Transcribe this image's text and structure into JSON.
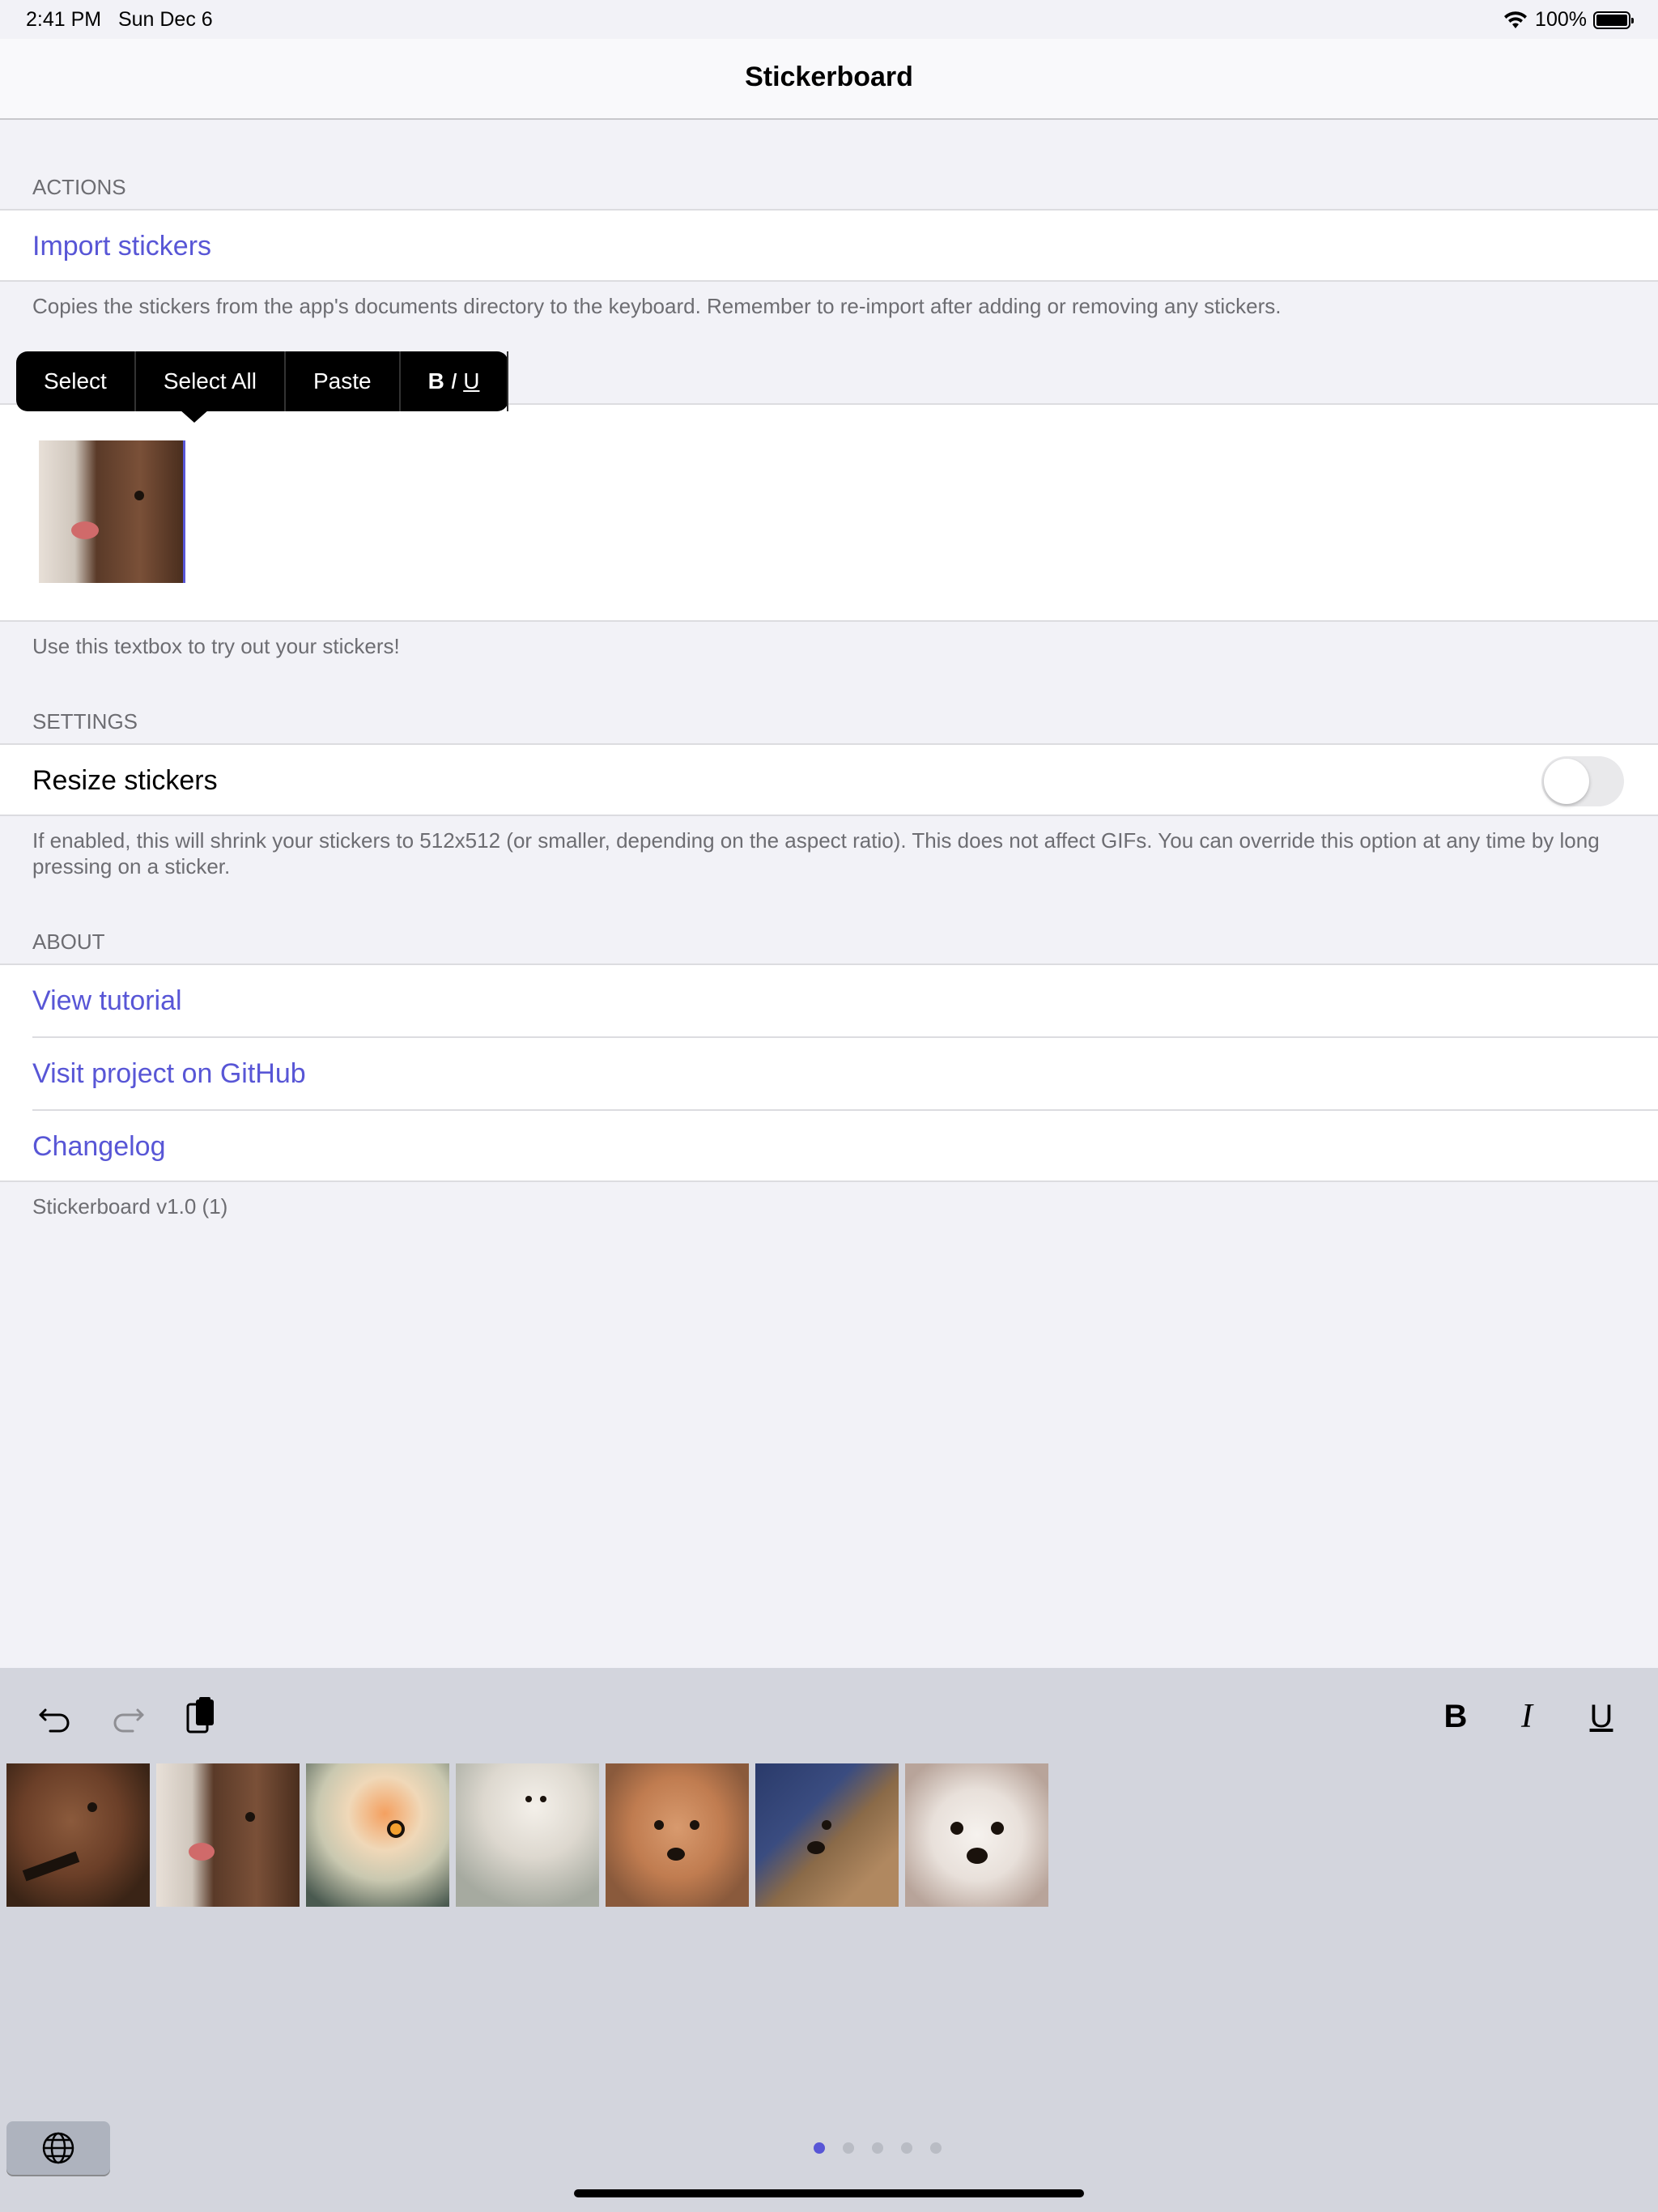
{
  "status": {
    "time": "2:41 PM",
    "date": "Sun Dec 6",
    "battery": "100%"
  },
  "nav": {
    "title": "Stickerboard"
  },
  "actions": {
    "header": "ACTIONS",
    "import_label": "Import stickers",
    "import_footer": "Copies the stickers from the app's documents directory to the keyboard. Remember to re-import after adding or removing any stickers."
  },
  "callout": {
    "select": "Select",
    "select_all": "Select All",
    "paste": "Paste",
    "bold": "B",
    "italic": "I",
    "underline": "U"
  },
  "textbox": {
    "footer": "Use this textbox to try out your stickers!"
  },
  "settings": {
    "header": "SETTINGS",
    "resize_label": "Resize stickers",
    "resize_enabled": false,
    "resize_footer": "If enabled, this will shrink your stickers to 512x512 (or smaller, depending on the aspect ratio). This does not affect GIFs. You can override this option at any time by long pressing on a sticker."
  },
  "about": {
    "header": "ABOUT",
    "items": [
      "View tutorial",
      "Visit project on GitHub",
      "Changelog"
    ],
    "version": "Stickerboard v1.0 (1)"
  },
  "keyboard": {
    "icons": [
      "undo-icon",
      "redo-icon",
      "paste-icon",
      "bold-icon",
      "italic-icon",
      "underline-icon"
    ],
    "bold": "B",
    "italic": "I",
    "underline": "U",
    "page_count": 5,
    "active_page": 1
  },
  "colors": {
    "accent": "#5856d6",
    "background": "#f2f2f7",
    "keyboard": "#d3d5dd"
  }
}
